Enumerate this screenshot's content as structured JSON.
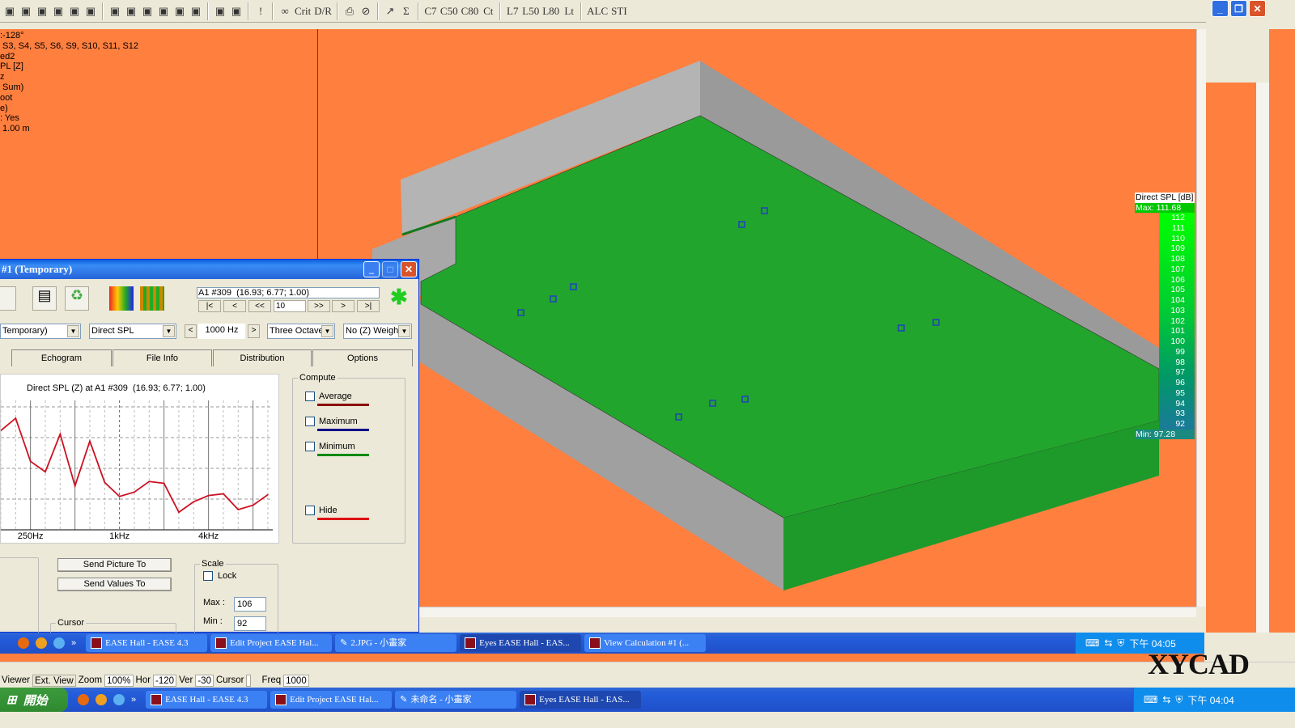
{
  "toolbar": {
    "left_icons": [
      "grid-icon",
      "frame-icon",
      "copy-icon",
      "print-icon",
      "window-icon",
      "color-map-icon",
      "cursor-icon",
      "speaker-icon",
      "speaker-off-icon",
      "room-icon",
      "wave-icon",
      "picture-icon",
      "hand-icon",
      "ear-icon"
    ],
    "buttons": [
      "!",
      "∞",
      "Crit",
      "D/R",
      "⎙",
      "⊘",
      "↗",
      "Σ",
      "C7",
      "C50",
      "C80",
      "Ct",
      "L7",
      "L50",
      "L80",
      "Lt",
      "ALC",
      "STI"
    ]
  },
  "viewport": {
    "info_lines": [
      ":-128°",
      " S3, S4, S5, S6, S9, S10, S11, S12",
      "ed2",
      "PL [Z]",
      "z",
      " Sum)",
      "oot",
      "e)",
      ": Yes",
      " 1.00 m"
    ],
    "colors": {
      "background": "#ff7f3f",
      "floor": "#1fa82a",
      "walls": "#a9a9a9"
    }
  },
  "legend": {
    "title": "Direct SPL [dB]",
    "max": "Max:  111.68",
    "min": "Min:  97.28",
    "levels": [
      "112",
      "111",
      "110",
      "109",
      "108",
      "107",
      "106",
      "105",
      "104",
      "103",
      "102",
      "101",
      "100",
      "99",
      "98",
      "97",
      "96",
      "95",
      "94",
      "93",
      "92"
    ]
  },
  "dialog": {
    "title": "#1 (Temporary)",
    "point_field": "A1 #309  (16.93; 6.77; 1.00)",
    "nav": {
      "first": "|<",
      "prev": "<",
      "prev_step": "<<",
      "step": "10",
      "next_step": ">>",
      "next": ">",
      "last": ">|"
    },
    "selects": {
      "calc": "Temporary)",
      "quantity": "Direct SPL",
      "freq": "1000 Hz",
      "bands": "Three Octave",
      "weighting": "No (Z) Weigh"
    },
    "tabs": [
      "Echogram",
      "File Info",
      "Distribution",
      "Options"
    ],
    "compute": {
      "label": "Compute",
      "items": [
        {
          "label": "Average",
          "color": "#8b0000"
        },
        {
          "label": "Maximum",
          "color": "#00108a"
        },
        {
          "label": "Minimum",
          "color": "#118a11"
        },
        {
          "label": "Hide",
          "color": "#dd1111"
        }
      ]
    },
    "send_picture": "Send Picture To",
    "send_values": "Send Values To",
    "scale": {
      "label": "Scale",
      "lock": "Lock",
      "max_label": "Max :",
      "max": "106",
      "min_label": "Min :",
      "min": "92"
    },
    "cursor_label": "Cursor"
  },
  "chart_data": {
    "type": "line",
    "title": "Direct SPL (Z) at A1 #309  (16.93; 6.77; 1.00)",
    "x": [
      160,
      200,
      250,
      315,
      400,
      500,
      630,
      800,
      1000,
      1250,
      1600,
      2000,
      2500,
      3150,
      4000,
      5000,
      6300,
      8000,
      10000
    ],
    "values": [
      103.3,
      104.7,
      99.8,
      98.6,
      102.9,
      97.0,
      102.1,
      97.4,
      95.8,
      96.3,
      97.5,
      97.3,
      94.0,
      95.2,
      95.9,
      96.1,
      94.3,
      94.8,
      96.0
    ],
    "tick_labels": [
      "250Hz",
      "1kHz",
      "4kHz"
    ],
    "ylim": [
      92,
      106
    ],
    "xscale": "log",
    "grid": true,
    "series_color": "#cc1122"
  },
  "taskbar1": {
    "items": [
      "EASE Hall - EASE 4.3",
      "Edit Project EASE Hal...",
      "2.JPG - 小畫家",
      "Eyes EASE Hall - EAS...",
      "View Calculation #1 (..."
    ],
    "clock": "下午 04:05"
  },
  "status": {
    "viewer": "Viewer",
    "ext_view": "Ext. View",
    "zoom_label": "Zoom",
    "zoom": "100%",
    "hor_label": "Hor",
    "hor": "-120",
    "ver_label": "Ver",
    "ver": "-30",
    "cursor_label": "Cursor",
    "freq_label": "Freq",
    "freq": "1000"
  },
  "taskbar2": {
    "start": "開始",
    "items": [
      "EASE Hall - EASE 4.3",
      "Edit Project EASE Hal...",
      "未命名 - 小畫家",
      "Eyes EASE Hall - EAS..."
    ],
    "clock": "下午 04:04"
  },
  "watermark": "XYCAD.com"
}
